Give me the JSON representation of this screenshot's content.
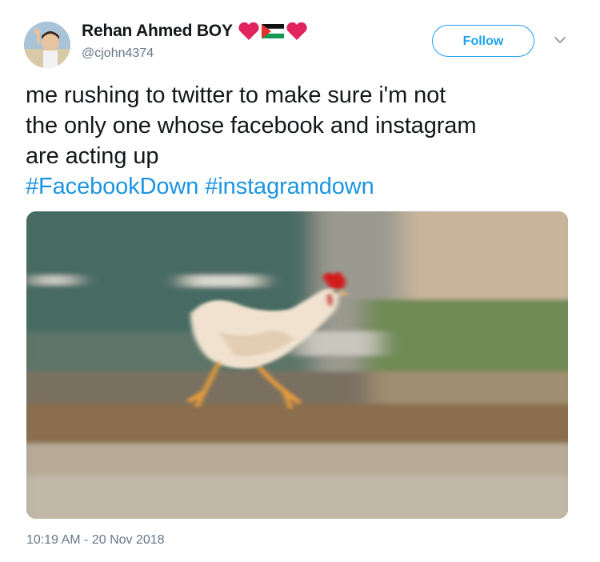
{
  "tweet": {
    "author": {
      "display_name": "Rehan Ahmed BOY",
      "handle": "@cjohn4374",
      "name_emojis": [
        "red-heart-icon",
        "palestine-flag-icon",
        "red-heart-icon"
      ]
    },
    "follow_label": "Follow",
    "text_line_1": "me rushing to twitter to make sure i'm not",
    "text_line_2": "the only one whose facebook and instagram",
    "text_line_3": "are acting up",
    "hashtags": [
      "#FacebookDown",
      "#instagramdown"
    ],
    "timestamp": "10:19 AM - 20 Nov 2018"
  },
  "colors": {
    "link_blue": "#1b95e0",
    "follow_blue": "#1da1f2",
    "secondary_text": "#657786",
    "primary_text": "#14171a",
    "heart_red": "#e0245e"
  }
}
